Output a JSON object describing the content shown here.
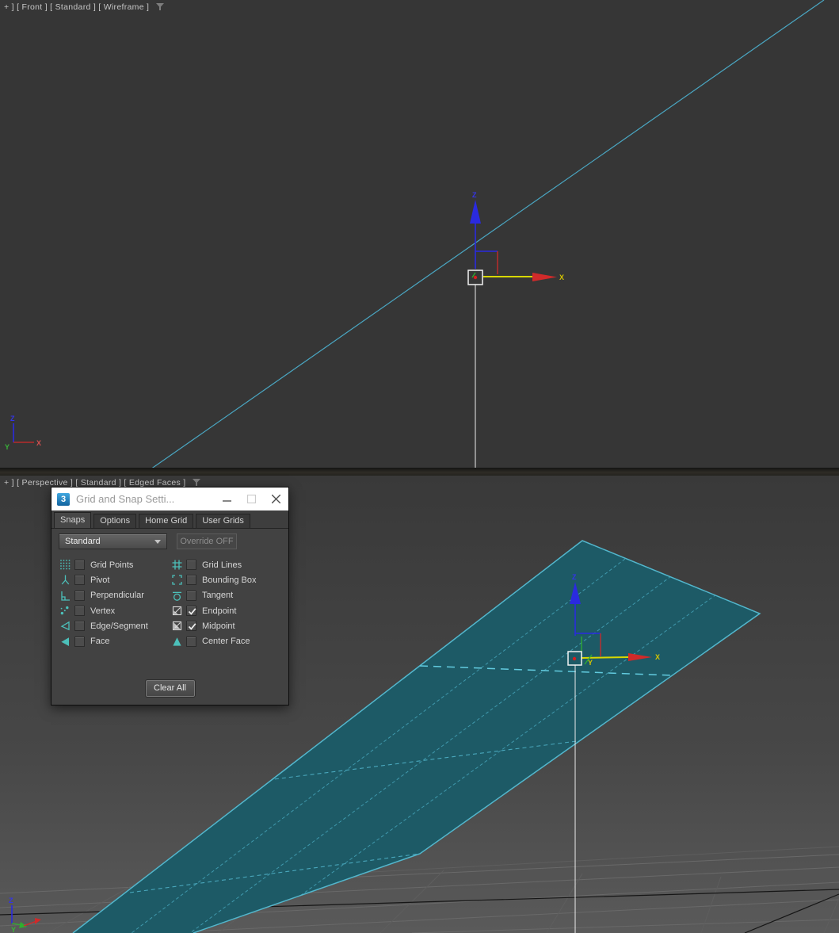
{
  "viewports": {
    "front": {
      "label": "+ ] [ Front ] [ Standard ] [ Wireframe ]"
    },
    "perspective": {
      "label": "+ ] [ Perspective ] [ Standard ] [ Edged Faces ]"
    }
  },
  "axis_labels": {
    "x": "X",
    "y": "Y",
    "z": "Z"
  },
  "dialog": {
    "app_icon_text": "3",
    "title": "Grid and Snap Setti...",
    "tabs": [
      "Snaps",
      "Options",
      "Home Grid",
      "User Grids"
    ],
    "active_tab": "Snaps",
    "preset_dropdown": {
      "value": "Standard"
    },
    "override_button": "Override OFF",
    "snap_items_left": [
      {
        "label": "Grid Points",
        "icon": "grid-points",
        "checked": false
      },
      {
        "label": "Pivot",
        "icon": "pivot",
        "checked": false
      },
      {
        "label": "Perpendicular",
        "icon": "perpendicular",
        "checked": false
      },
      {
        "label": "Vertex",
        "icon": "vertex",
        "checked": false
      },
      {
        "label": "Edge/Segment",
        "icon": "edge-segment",
        "checked": false
      },
      {
        "label": "Face",
        "icon": "face",
        "checked": false
      }
    ],
    "snap_items_right": [
      {
        "label": "Grid Lines",
        "icon": "grid-lines",
        "checked": false
      },
      {
        "label": "Bounding Box",
        "icon": "bounding-box",
        "checked": false
      },
      {
        "label": "Tangent",
        "icon": "tangent",
        "checked": false
      },
      {
        "label": "Endpoint",
        "icon": "endpoint",
        "checked": true
      },
      {
        "label": "Midpoint",
        "icon": "midpoint",
        "checked": true
      },
      {
        "label": "Center Face",
        "icon": "center-face",
        "checked": false
      }
    ],
    "clear_button": "Clear All"
  },
  "colors": {
    "accent_teal": "#4cc0ba",
    "axis_x_red": "#d02a2a",
    "axis_y_green": "#2faf2f",
    "axis_z_blue": "#2a2ae0",
    "highlight_yellow": "#d8d800",
    "wireframe_cyan": "#4aa6c2",
    "plane_fill": "#1d5a66",
    "plane_edge": "#52b6cc"
  }
}
